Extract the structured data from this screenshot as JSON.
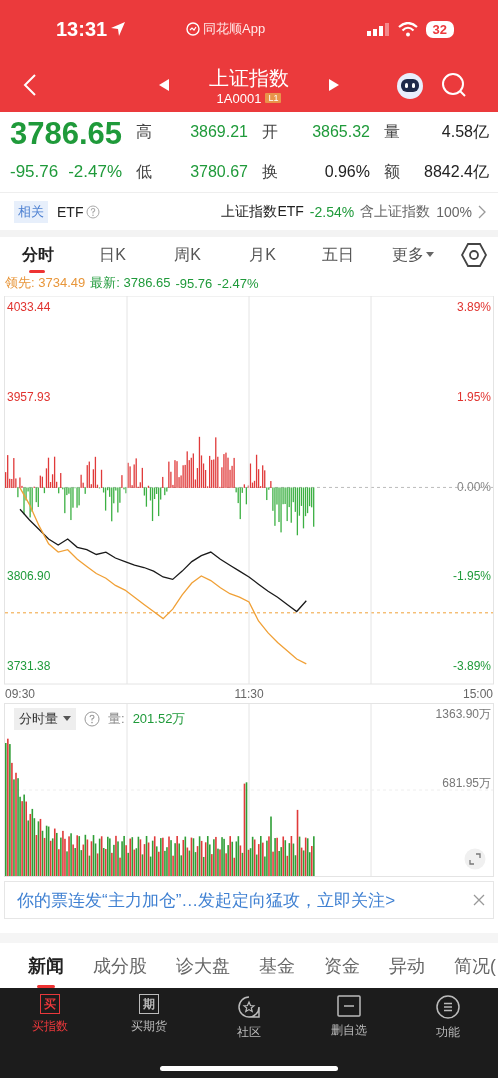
{
  "status_bar": {
    "time": "13:31",
    "app": "同花顺App",
    "battery": "32"
  },
  "header": {
    "title": "上证指数",
    "code": "1A0001",
    "badge": "L1"
  },
  "quote": {
    "price": "3786.65",
    "change": "-95.76",
    "change_pct": "-2.47%",
    "stats": [
      {
        "label": "高",
        "value": "3869.21",
        "color": "#1f9a3a"
      },
      {
        "label": "开",
        "value": "3865.32",
        "color": "#1f9a3a"
      },
      {
        "label": "量",
        "value": "4.58亿",
        "color": "#222222"
      },
      {
        "label": "低",
        "value": "3780.67",
        "color": "#1f9a3a"
      },
      {
        "label": "换",
        "value": "0.96%",
        "color": "#222222"
      },
      {
        "label": "额",
        "value": "8842.4亿",
        "color": "#222222"
      }
    ]
  },
  "related": {
    "tag": "相关",
    "label": "ETF",
    "etf_name": "上证指数ETF",
    "etf_change": "-2.54%",
    "holding": "含上证指数",
    "holding_pct": "100%"
  },
  "chart_tabs": [
    {
      "label": "分时",
      "selected": true,
      "kind": "tab"
    },
    {
      "label": "日K",
      "selected": false,
      "kind": "tab"
    },
    {
      "label": "周K",
      "selected": false,
      "kind": "tab"
    },
    {
      "label": "月K",
      "selected": false,
      "kind": "tab"
    },
    {
      "label": "五日",
      "selected": false,
      "kind": "tab"
    },
    {
      "label": "更多",
      "selected": false,
      "kind": "dropdown"
    }
  ],
  "legend": {
    "lead_label": "领先:",
    "lead_value": "3734.49",
    "latest_label": "最新:",
    "latest_value": "3786.65",
    "change": "-95.76",
    "change_pct": "-2.47%"
  },
  "intraday_chart": {
    "percent_labels": [
      {
        "label": "3.89%",
        "color": "#e0332f"
      },
      {
        "label": "1.95%",
        "color": "#e0332f"
      },
      {
        "label": "0.00%",
        "color": "#888888"
      },
      {
        "label": "-1.95%",
        "color": "#1f9a3a"
      },
      {
        "label": "-3.89%",
        "color": "#1f9a3a"
      }
    ],
    "chart_data": {
      "type": "line",
      "categories": [
        "09:30",
        null,
        null,
        null,
        null,
        null,
        null,
        null,
        null,
        null,
        null,
        null,
        null,
        null,
        null,
        null,
        null,
        null,
        null,
        null,
        null,
        null,
        null,
        null,
        "11:30",
        null,
        null,
        null,
        null,
        null,
        null,
        null,
        null,
        null,
        null,
        null,
        null,
        null,
        null,
        null,
        null,
        null,
        null,
        null,
        null,
        null,
        null,
        null,
        "15:00"
      ],
      "series": [
        {
          "color": "#1a1a1a",
          "values": [
            3864,
            3855,
            3847,
            3839,
            3834,
            3839,
            3832,
            3830,
            3826,
            3828,
            3823,
            3820,
            3817,
            3815,
            3812,
            3807,
            3805,
            3812,
            3820,
            3825,
            3828,
            3822,
            3817,
            3812,
            3807,
            3801,
            3795,
            3790,
            3784,
            3778,
            3787,
            null,
            null,
            null,
            null,
            null,
            null,
            null,
            null,
            null,
            null,
            null,
            null,
            null,
            null,
            null,
            null,
            null,
            null
          ]
        },
        {
          "color": "#f0a036",
          "values": [
            3882,
            3868,
            3850,
            3835,
            3828,
            3830,
            3822,
            3816,
            3810,
            3806,
            3800,
            3796,
            3790,
            3784,
            3778,
            3772,
            3780,
            3792,
            3802,
            3808,
            3804,
            3798,
            3793,
            3790,
            3786,
            3770,
            3760,
            3752,
            3745,
            3738,
            3734,
            null,
            null,
            null,
            null,
            null,
            null,
            null,
            null,
            null,
            null,
            null,
            null,
            null,
            null,
            null,
            null,
            null,
            null
          ]
        }
      ],
      "ylim": [
        3717,
        4043.5
      ],
      "yticks": [
        {
          "value": 4033.44,
          "label": "4033.44"
        },
        {
          "value": 3957.93,
          "label": "3957.93"
        },
        {
          "value": 3806.9,
          "label": "3806.90"
        },
        {
          "value": 3731.38,
          "label": "3731.38"
        }
      ]
    }
  },
  "volume": {
    "selector": "分时量",
    "vol_label": "量:",
    "vol_value": "201.52万",
    "max_label": "1363.90万",
    "mid_label": "681.95万"
  },
  "banner": {
    "text": "你的票连发“主力加仓”…发起定向猛攻，立即关注>"
  },
  "news_tabs": [
    {
      "label": "新闻",
      "selected": true
    },
    {
      "label": "成分股",
      "selected": false
    },
    {
      "label": "诊大盘",
      "selected": false
    },
    {
      "label": "基金",
      "selected": false
    },
    {
      "label": "资金",
      "selected": false
    },
    {
      "label": "异动",
      "selected": false
    },
    {
      "label": "简况(",
      "selected": false
    }
  ],
  "bottom_nav": [
    {
      "label": "买指数",
      "selected": true,
      "kind": "buy",
      "glyph": "买"
    },
    {
      "label": "买期货",
      "selected": false,
      "kind": "futures",
      "glyph": "期"
    },
    {
      "label": "社区",
      "selected": false,
      "kind": "community"
    },
    {
      "label": "删自选",
      "selected": false,
      "kind": "remove"
    },
    {
      "label": "功能",
      "selected": false,
      "kind": "menu"
    }
  ]
}
